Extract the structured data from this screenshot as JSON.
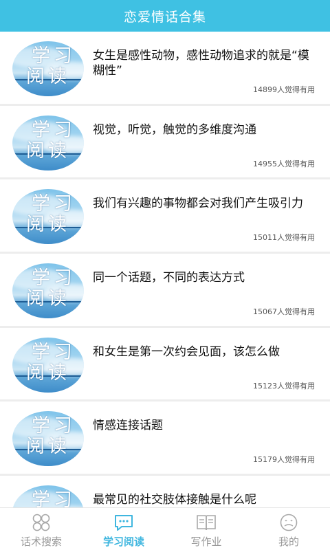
{
  "header": {
    "title": "恋爱情话合集"
  },
  "thumb": {
    "line1": "学习",
    "line2": "阅读"
  },
  "articles": [
    {
      "title": "女生是感性动物，感性动物追求的就是“模糊性”",
      "count": "14899人觉得有用"
    },
    {
      "title": "视觉，听觉，触觉的多维度沟通",
      "count": "14955人觉得有用"
    },
    {
      "title": "我们有兴趣的事物都会对我们产生吸引力",
      "count": "15011人觉得有用"
    },
    {
      "title": "同一个话题，不同的表达方式",
      "count": "15067人觉得有用"
    },
    {
      "title": "和女生是第一次约会见面，该怎么做",
      "count": "15123人觉得有用"
    },
    {
      "title": "情感连接话题",
      "count": "15179人觉得有用"
    },
    {
      "title": "最常见的社交肢体接触是什么呢",
      "count": ""
    }
  ],
  "tabs": [
    {
      "label": "话术搜索",
      "icon": "grid-icon",
      "active": false
    },
    {
      "label": "学习阅读",
      "icon": "chat-bubble-icon",
      "active": true
    },
    {
      "label": "写作业",
      "icon": "book-icon",
      "active": false
    },
    {
      "label": "我的",
      "icon": "user-icon",
      "active": false
    }
  ],
  "colors": {
    "accent": "#3fc1e3",
    "active_tab": "#3fb6df",
    "inactive_tab": "#999999"
  }
}
